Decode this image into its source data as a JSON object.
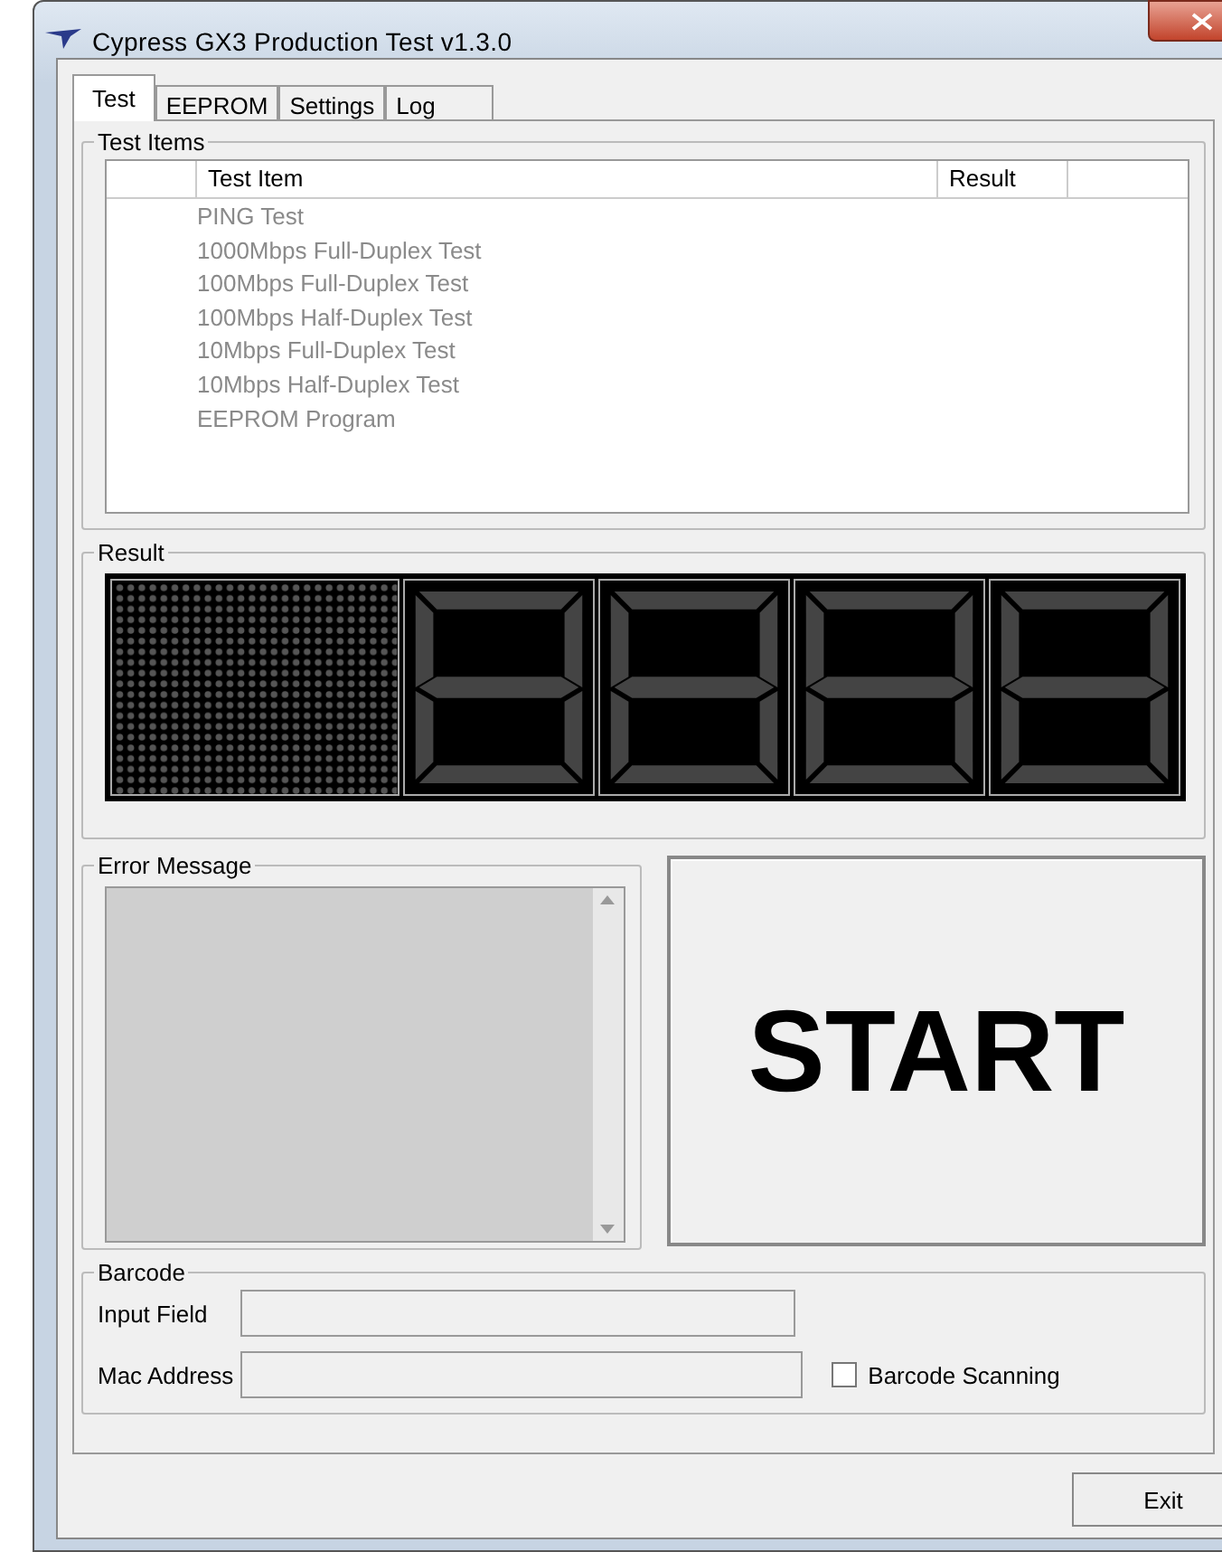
{
  "window": {
    "title": "Cypress GX3 Production Test v1.3.0"
  },
  "tabs": [
    {
      "label": "Test",
      "selected": true
    },
    {
      "label": "EEPROM",
      "selected": false
    },
    {
      "label": "Settings",
      "selected": false
    },
    {
      "label": "Log",
      "selected": false
    }
  ],
  "test_items": {
    "title": "Test Items",
    "columns": [
      "Test Item",
      "Result"
    ],
    "rows": [
      {
        "name": "PING Test",
        "disabled": true
      },
      {
        "name": "1000Mbps Full-Duplex Test",
        "disabled": true
      },
      {
        "name": "100Mbps Full-Duplex Test",
        "disabled": true
      },
      {
        "name": "100Mbps Half-Duplex Test",
        "disabled": true
      },
      {
        "name": "10Mbps Full-Duplex Test",
        "disabled": true
      },
      {
        "name": "10Mbps Half-Duplex Test",
        "disabled": true
      },
      {
        "name": "EEPROM Program",
        "disabled": true
      }
    ]
  },
  "result": {
    "title": "Result"
  },
  "error_message": {
    "title": "Error Message"
  },
  "start_button": {
    "label": "START"
  },
  "barcode": {
    "title": "Barcode",
    "input_field_label": "Input Field",
    "mac_address_label": "Mac Address",
    "scanning": {
      "label": "Barcode Scanning",
      "checked": false
    }
  },
  "buttons": [
    "Exit"
  ]
}
